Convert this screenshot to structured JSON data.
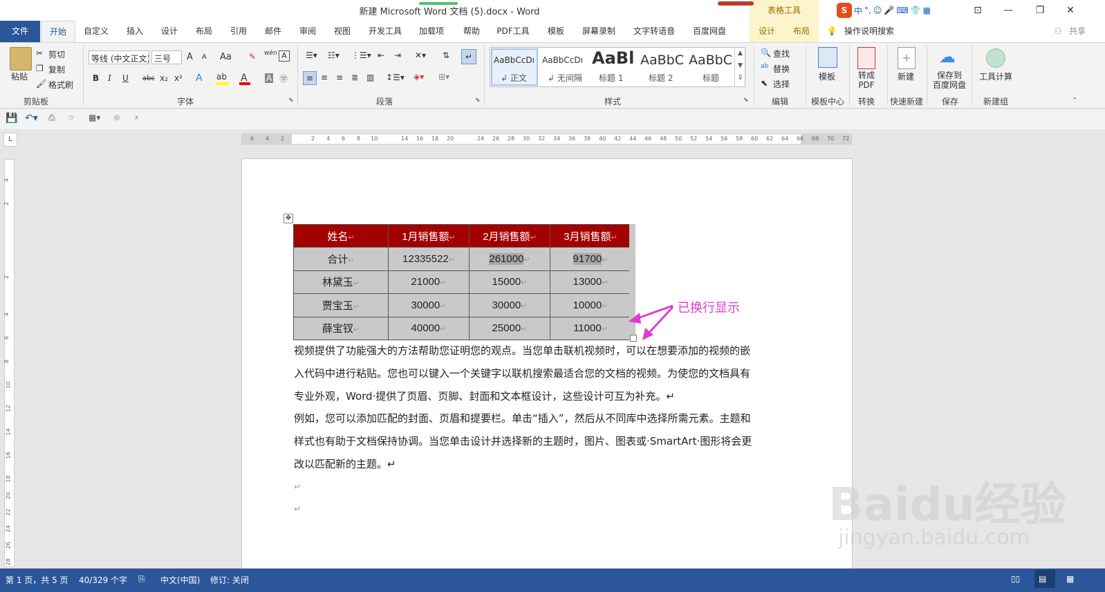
{
  "titlebar": {
    "title": "新建 Microsoft Word 文档 (5).docx  -  Word",
    "contextual_group": "表格工具",
    "ime_logo": "S",
    "ime_lang": "中",
    "ime_punct": "°,"
  },
  "tabs": [
    "文件",
    "开始",
    "自定义",
    "插入",
    "设计",
    "布局",
    "引用",
    "邮件",
    "审阅",
    "视图",
    "开发工具",
    "加载项",
    "帮助",
    "PDF工具",
    "模板",
    "屏幕录制",
    "文字转语音",
    "百度网盘",
    "设计",
    "布局"
  ],
  "tell_me": "操作说明搜索",
  "share": "共享",
  "ribbon": {
    "clipboard": {
      "paste": "粘贴",
      "cut": "剪切",
      "copy": "复制",
      "format_painter": "格式刷",
      "label": "剪贴板"
    },
    "font": {
      "font_name": "等线 (中文正文)",
      "font_size": "三号",
      "grow": "A",
      "shrink": "A",
      "case": "Aa",
      "bold": "B",
      "italic": "I",
      "underline": "U",
      "strike": "abc",
      "sub": "x₂",
      "sup": "x²",
      "label": "字体",
      "phonetic": "wén",
      "border_char": "A"
    },
    "paragraph": {
      "label": "段落"
    },
    "styles": {
      "items": [
        {
          "preview": "AaBbCcDı",
          "name": "↲ 正文"
        },
        {
          "preview": "AaBbCcDı",
          "name": "↲ 无间隔"
        },
        {
          "preview": "AaBl",
          "name": "标题 1"
        },
        {
          "preview": "AaBbC",
          "name": "标题 2"
        },
        {
          "preview": "AaBbC",
          "name": "标题"
        }
      ],
      "label": "样式"
    },
    "editing": {
      "find": "查找",
      "replace": "替换",
      "select": "选择",
      "label": "编辑"
    },
    "template": {
      "btn": "模板",
      "label": "模板中心"
    },
    "convert": {
      "btn": "转成\nPDF",
      "label": "转换"
    },
    "new": {
      "btn": "新建",
      "label": "快速新建"
    },
    "save": {
      "btn": "保存到\n百度网盘",
      "label": "保存"
    },
    "calc": {
      "btn": "工具计算",
      "label": "新建组"
    }
  },
  "ruler": {
    "h": [
      "6",
      "4",
      "2",
      "2",
      "4",
      "6",
      "8",
      "10",
      "14",
      "16",
      "18",
      "20",
      "24",
      "26",
      "28",
      "30",
      "32",
      "34",
      "36",
      "38",
      "40",
      "42",
      "44",
      "46",
      "48",
      "50",
      "52",
      "54",
      "56",
      "58",
      "60",
      "62",
      "64",
      "66",
      "68",
      "70",
      "72"
    ],
    "v": [
      "4",
      "2",
      "2",
      "4",
      "6",
      "8",
      "10",
      "12",
      "14",
      "16",
      "18",
      "20",
      "22",
      "24",
      "26",
      "28"
    ]
  },
  "table": {
    "headers": [
      "姓名",
      "1月销售额",
      "2月销售额",
      "3月销售额"
    ],
    "rows": [
      [
        "合计",
        "12335522",
        "261000",
        "91700"
      ],
      [
        "林黛玉",
        "21000",
        "15000",
        "13000"
      ],
      [
        "贾宝玉",
        "30000",
        "30000",
        "10000"
      ],
      [
        "薛宝钗",
        "40000",
        "25000",
        "11000"
      ]
    ],
    "colors": {
      "header_bg": "#a30000",
      "header_fg": "#ffffff",
      "cell_bg": "#c9c9c9"
    }
  },
  "paragraphs": [
    "视频提供了功能强大的方法帮助您证明您的观点。当您单击联机视频时，可以在想要添加的视频的嵌",
    "入代码中进行粘贴。您也可以键入一个关键字以联机搜索最适合您的文档的视频。为使您的文档具有",
    "专业外观，Word·提供了页眉、页脚、封面和文本框设计，这些设计可互为补充。↵",
    "例如，您可以添加匹配的封面、页眉和提要栏。单击“插入”，然后从不同库中选择所需元素。主题和",
    "样式也有助于文档保持协调。当您单击设计并选择新的主题时，图片、图表或·SmartArt·图形将会更",
    "改以匹配新的主题。↵",
    "↵",
    "↵"
  ],
  "annotation": "已换行显示",
  "statusbar": {
    "page": "第 1 页，共 5 页",
    "words": "40/329 个字",
    "lang": "中文(中国)",
    "track": "修订: 关闭"
  },
  "watermark": {
    "brand": "Baidu经验",
    "url": "jingyan.baidu.com"
  },
  "colors": {
    "accent": "#2b579a",
    "annotation": "#e03bd3",
    "table_header": "#a30000"
  }
}
